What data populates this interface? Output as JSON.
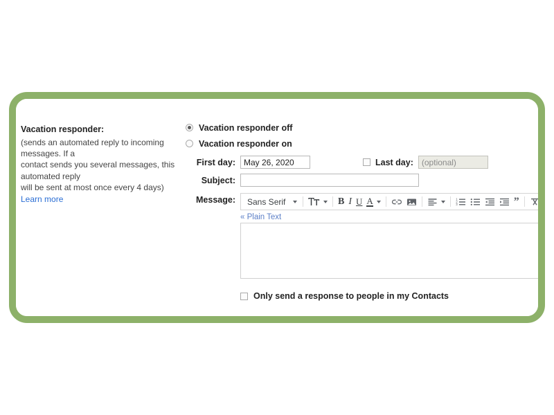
{
  "theme": {
    "frame_color": "#8db169",
    "link_color": "#2b6ed4",
    "plain_text_link_color": "#5b7fc7",
    "card_background": "#ffffff"
  },
  "left_panel": {
    "heading": "Vacation responder:",
    "description_line1": "(sends an automated reply to incoming messages. If a",
    "description_line2": "contact sends you several messages, this automated reply",
    "description_line3": "will be sent at most once every 4 days)",
    "learn_more_label": "Learn more"
  },
  "form": {
    "radio_off_label": "Vacation responder off",
    "radio_on_label": "Vacation responder on",
    "radio_selected": "off",
    "first_day_label": "First day:",
    "first_day_value": "May 26, 2020",
    "last_day_label": "Last day:",
    "last_day_value": "",
    "last_day_placeholder": "(optional)",
    "last_day_checked": false,
    "subject_label": "Subject:",
    "subject_value": "",
    "message_label": "Message:",
    "message_value": "",
    "plain_text_label": "« Plain Text",
    "contacts_checkbox_label": "Only send a response to people in my Contacts",
    "contacts_checked": false
  },
  "toolbar": {
    "font_family_value": "Sans Serif",
    "items": [
      {
        "name": "font-family-select",
        "label": "Sans Serif"
      },
      {
        "name": "font-size-button",
        "label": "Size"
      },
      {
        "name": "bold-button",
        "label": "B"
      },
      {
        "name": "italic-button",
        "label": "I"
      },
      {
        "name": "underline-button",
        "label": "U"
      },
      {
        "name": "text-color-button",
        "label": "A"
      },
      {
        "name": "insert-link-button",
        "label": "Link"
      },
      {
        "name": "insert-image-button",
        "label": "Image"
      },
      {
        "name": "align-button",
        "label": "Align"
      },
      {
        "name": "numbered-list-button",
        "label": "Numbered list"
      },
      {
        "name": "bulleted-list-button",
        "label": "Bulleted list"
      },
      {
        "name": "indent-less-button",
        "label": "Indent less"
      },
      {
        "name": "indent-more-button",
        "label": "Indent more"
      },
      {
        "name": "quote-button",
        "label": "Quote"
      },
      {
        "name": "remove-formatting-button",
        "label": "Remove formatting"
      }
    ]
  }
}
